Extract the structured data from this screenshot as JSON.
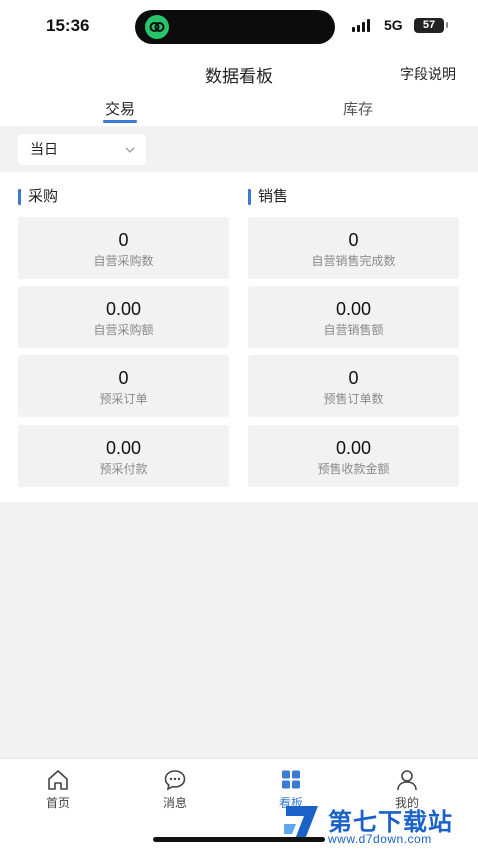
{
  "status_bar": {
    "time": "15:36",
    "network": "5G",
    "battery": "57"
  },
  "nav": {
    "title": "数据看板",
    "action": "字段说明"
  },
  "tabs": [
    {
      "label": "交易",
      "active": true
    },
    {
      "label": "库存",
      "active": false
    }
  ],
  "filter": {
    "date_range": "当日"
  },
  "purchase": {
    "title": "采购",
    "cards": [
      {
        "value": "0",
        "label": "自营采购数"
      },
      {
        "value": "0.00",
        "label": "自营采购额"
      },
      {
        "value": "0",
        "label": "预采订单"
      },
      {
        "value": "0.00",
        "label": "预采付款"
      }
    ]
  },
  "sales": {
    "title": "销售",
    "cards": [
      {
        "value": "0",
        "label": "自营销售完成数"
      },
      {
        "value": "0.00",
        "label": "自营销售额"
      },
      {
        "value": "0",
        "label": "预售订单数"
      },
      {
        "value": "0.00",
        "label": "预售收款金额"
      }
    ]
  },
  "tabbar": [
    {
      "label": "首页",
      "icon": "home-icon",
      "active": false
    },
    {
      "label": "消息",
      "icon": "message-icon",
      "active": false
    },
    {
      "label": "看板",
      "icon": "dashboard-icon",
      "active": true
    },
    {
      "label": "我的",
      "icon": "user-icon",
      "active": false
    }
  ],
  "colors": {
    "accent": "#3a7bd5",
    "background_gray": "#f2f2f2"
  },
  "watermark": {
    "title": "第七下载站",
    "url": "www.d7down.com"
  }
}
